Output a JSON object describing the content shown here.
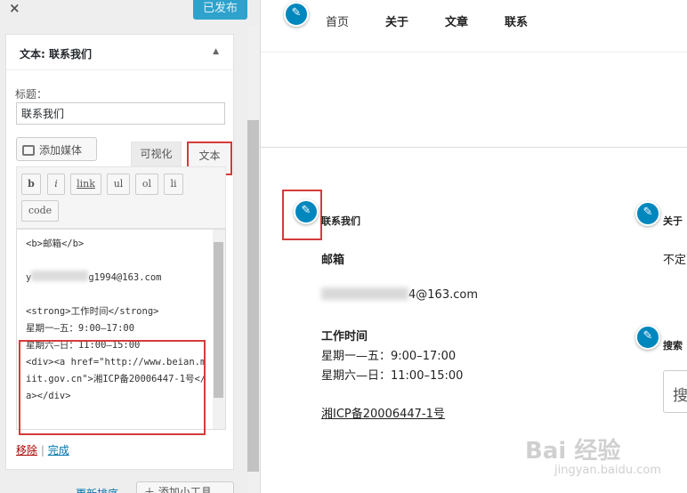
{
  "header": {
    "close_icon": "×",
    "publish_label": "已发布"
  },
  "widget": {
    "title": "文本: 联系我们",
    "title_label": "标题：",
    "title_value": "联系我们",
    "add_media_label": "添加媒体",
    "tab_visual": "可视化",
    "tab_text": "文本",
    "quicktags": [
      "b",
      "i",
      "link",
      "ul",
      "ol",
      "li",
      "code"
    ],
    "code_line_1": "<b>邮箱</b>",
    "code_line_2_prefix": "y",
    "code_line_2_suffix": "g1994@163.com",
    "code_line_3": "<strong>工作时间</strong>",
    "code_line_4": "星期一—五：9:00–17:00",
    "code_line_5": "星期六—日：11:00–15:00",
    "code_line_6": "<div><a href=\"http://www.beian.miit.gov.cn\">湘ICP备20006447-1号</a></div>",
    "remove_label": "移除",
    "sep": "|",
    "done_label": "完成"
  },
  "footer": {
    "reorder_label": "更新排序",
    "add_widget_label": "＋ 添加小工具"
  },
  "preview": {
    "nav": [
      "首页",
      "关于",
      "文章",
      "联系"
    ],
    "contact": {
      "title": "联系我们",
      "email_label": "邮箱",
      "email_suffix": "4@163.com",
      "hours_label": "工作时间",
      "hours_1": "星期一—五：9:00–17:00",
      "hours_2": "星期六—日：11:00–15:00",
      "icp": "湘ICP备20006447-1号"
    },
    "about_title": "关于",
    "about_text": "不定",
    "search_title": "搜索",
    "search_icon_text": "搜"
  },
  "watermark": {
    "main": "Bai  经验",
    "sub": "jingyan.baidu.com"
  },
  "colors": {
    "accent": "#0087be",
    "publish": "#2ea2cc",
    "highlight": "#d53b3b"
  }
}
